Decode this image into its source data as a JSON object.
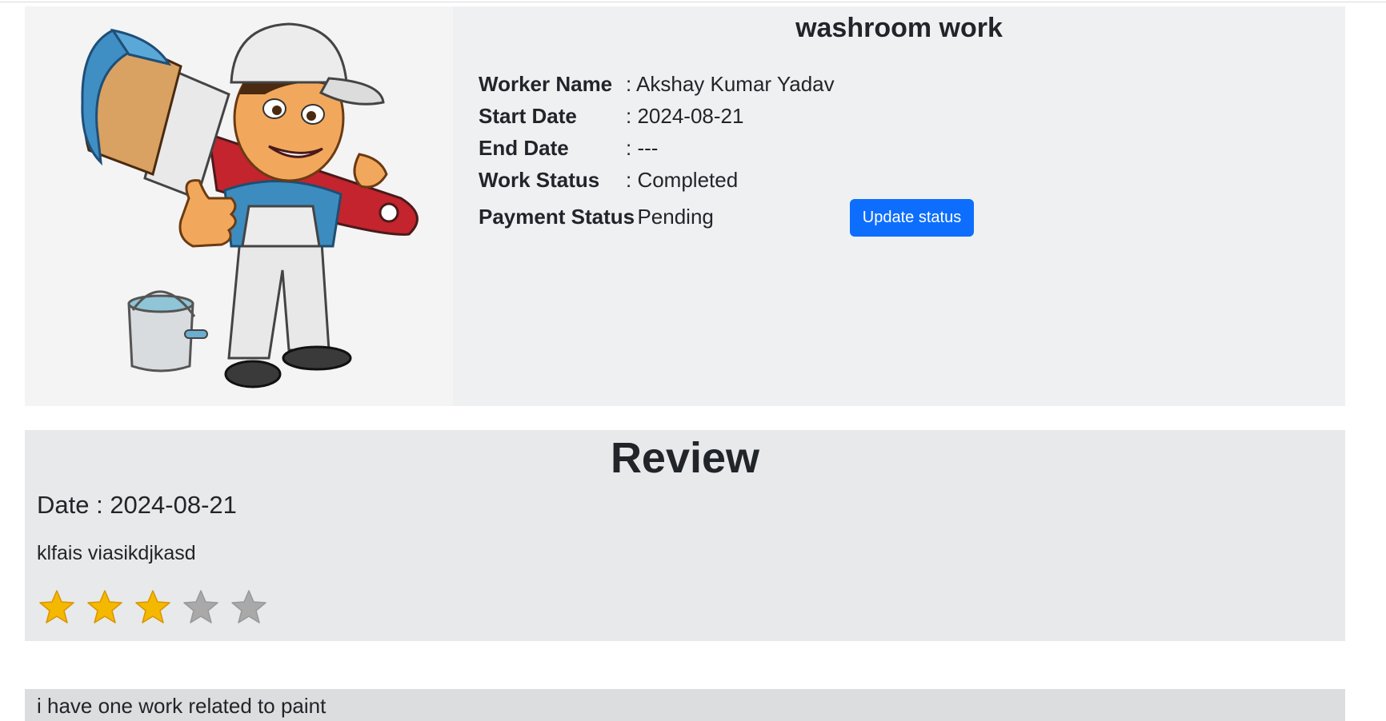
{
  "work": {
    "title": "washroom work",
    "image_name": "painter-illustration",
    "fields": [
      {
        "label": "Worker Name",
        "value": ": Akshay Kumar Yadav"
      },
      {
        "label": "Start Date",
        "value": ": 2024-08-21"
      },
      {
        "label": "End Date",
        "value": ": ---"
      },
      {
        "label": "Work Status",
        "value": ": Completed"
      },
      {
        "label": "Payment Status",
        "value": ": Pending"
      }
    ],
    "update_button_label": "Update status",
    "button_color": "#0d6efd"
  },
  "review": {
    "heading": "Review",
    "date_text": "Date : 2024-08-21",
    "comment": "klfais viasikdjkasd",
    "rating": 3,
    "rating_max": 5,
    "star_filled_color": "#f5b800",
    "star_empty_color": "#a9a9a9"
  },
  "next_card": {
    "title": "i have one work related to paint"
  }
}
